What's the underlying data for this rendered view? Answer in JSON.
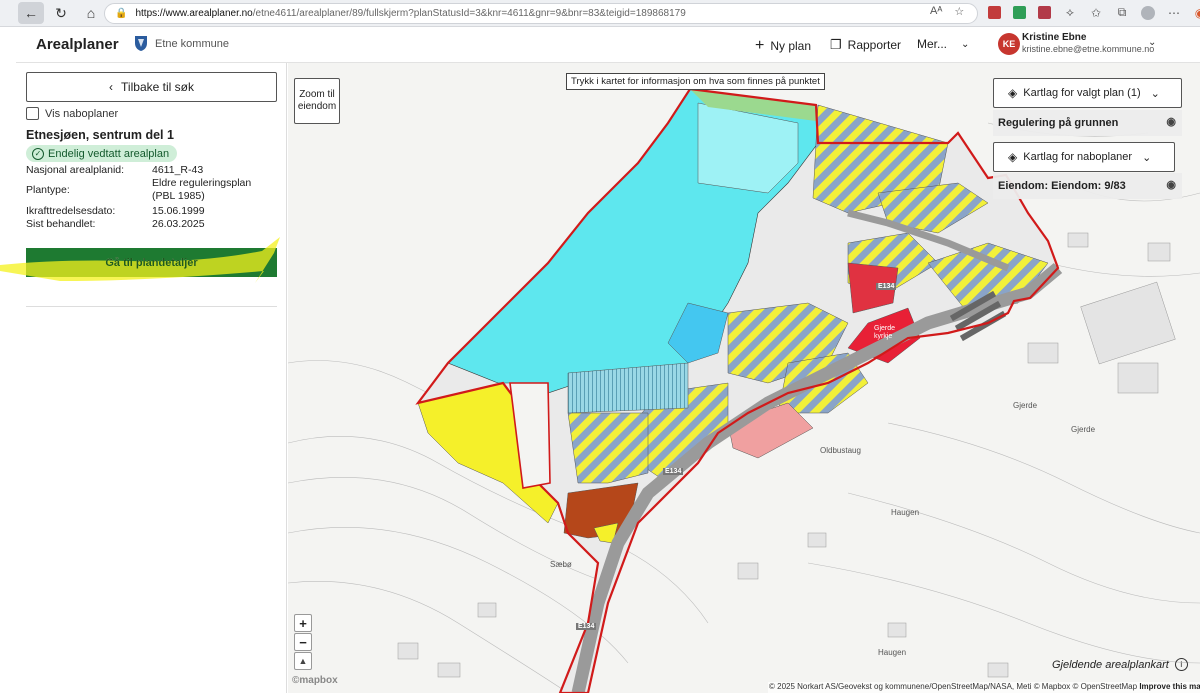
{
  "browser": {
    "url_host": "https://www.arealplaner.no",
    "url_rest": "/etne4611/arealplaner/89/fullskjerm?planStatusId=3&knr=4611&gnr=9&bnr=83&teigid=189868179",
    "ext_colors": [
      "#c23b3b",
      "#2f9e57",
      "#b23a48"
    ]
  },
  "header": {
    "app_title": "Arealplaner",
    "kommune": "Etne kommune",
    "nav": {
      "new_plan": "Ny plan",
      "reports": "Rapporter",
      "more": "Mer..."
    },
    "user": {
      "initials": "KE",
      "name": "Kristine Ebne",
      "email": "kristine.ebne@etne.kommune.no"
    }
  },
  "sidebar": {
    "back_label": "Tilbake til søk",
    "neighbour_label": "Vis naboplaner",
    "plan_name": "Etnesjøen, sentrum del 1",
    "status": "Endelig vedtatt arealplan",
    "fields": {
      "national_id_label": "Nasjonal arealplanid:",
      "national_id_value": "4611_R-43",
      "plantype_label": "Plantype:",
      "plantype_value_1": "Eldre reguleringsplan",
      "plantype_value_2": "(PBL 1985)",
      "effective_label": "Ikrafttredelsesdato:",
      "effective_value": "15.06.1999",
      "last_treated_label": "Sist behandlet:",
      "last_treated_value": "26.03.2025"
    },
    "go_label": "Gå til plandetaljer"
  },
  "map": {
    "zoom_to_property_1": "Zoom til",
    "zoom_to_property_2": "eiendom",
    "tip": "Trykk i kartet for informasjon om hva som finnes på punktet",
    "layers_selected": "Kartlag for valgt plan (1)",
    "layer_regulation": "Regulering på grunnen",
    "layers_neighbour": "Kartlag for naboplaner",
    "layer_property": "Eiendom: Eiendom: 9/83",
    "zoom_in": "+",
    "zoom_out": "−",
    "mapbox": "©mapbox",
    "plankart": "Gjeldende arealplankart",
    "attribution": "© 2025 Norkart AS/Geovekst og kommunene/OpenStreetMap/NASA, Meti © Mapbox © OpenStreetMap",
    "improve": "Improve this map",
    "places": {
      "gjerde_1": "Gjerde",
      "gjerde_2": "Gjerde",
      "oldbustaug": "Oldbustaug",
      "haugen_1": "Haugen",
      "haugen_2": "Haugen",
      "saebo": "Sæbø",
      "road_e134_1": "E134",
      "road_e134_2": "E134",
      "road_e134_3": "E134",
      "area_label": "Gjerde kyrkje"
    }
  }
}
